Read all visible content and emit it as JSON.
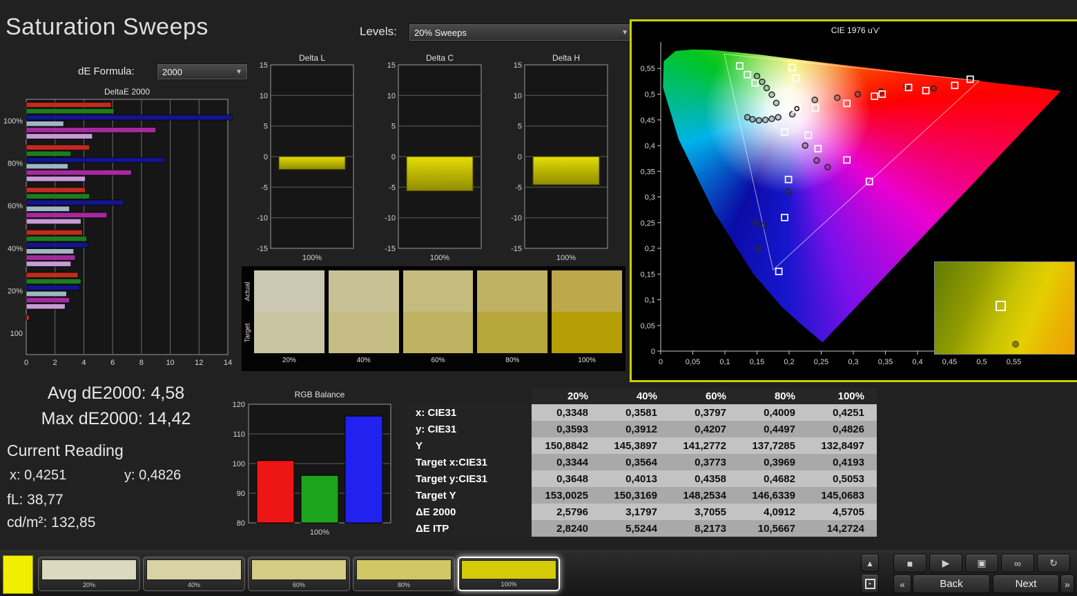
{
  "header": {
    "title": "Saturation Sweeps",
    "levels_label": "Levels:",
    "levels_value": "20% Sweeps"
  },
  "de_formula": {
    "label": "dE Formula:",
    "value": "2000"
  },
  "icons": {
    "dropdown_arrow": "▼",
    "stop": "■",
    "play": "▶",
    "capture": "▣",
    "continuous": "∞",
    "loop": "↻",
    "chevrons_left": "«",
    "chevrons_right": "»",
    "panel_up": "▴",
    "pattern_square": "▪"
  },
  "stats": {
    "avg": "Avg dE2000: 4,58",
    "max": "Max dE2000: 14,42",
    "current_reading_label": "Current Reading",
    "x": "x: 0,4251",
    "y": "y: 0,4826",
    "fl": "fL: 38,77",
    "cdm2": "cd/m²: 132,85"
  },
  "swatch_strip": {
    "row_labels": [
      "Actual",
      "Target"
    ],
    "columns": [
      {
        "label": "20%",
        "actual": "#cbc7b2",
        "target": "#c9c5a3"
      },
      {
        "label": "40%",
        "actual": "#c8c196",
        "target": "#c5bd83"
      },
      {
        "label": "60%",
        "actual": "#c4bb7c",
        "target": "#bfb260"
      },
      {
        "label": "80%",
        "actual": "#c0b263",
        "target": "#b7a63a"
      },
      {
        "label": "100%",
        "actual": "#bda84b",
        "target": "#b69e06"
      }
    ]
  },
  "table": {
    "headers": [
      "",
      "20%",
      "40%",
      "60%",
      "80%",
      "100%"
    ],
    "rows": [
      {
        "label": "x: CIE31",
        "values": [
          "0,3348",
          "0,3581",
          "0,3797",
          "0,4009",
          "0,4251"
        ]
      },
      {
        "label": "y: CIE31",
        "values": [
          "0,3593",
          "0,3912",
          "0,4207",
          "0,4497",
          "0,4826"
        ]
      },
      {
        "label": "Y",
        "values": [
          "150,8842",
          "145,3897",
          "141,2772",
          "137,7285",
          "132,8497"
        ]
      },
      {
        "label": "Target x:CIE31",
        "values": [
          "0,3344",
          "0,3564",
          "0,3773",
          "0,3969",
          "0,4193"
        ]
      },
      {
        "label": "Target y:CIE31",
        "values": [
          "0,3648",
          "0,4013",
          "0,4358",
          "0,4682",
          "0,5053"
        ]
      },
      {
        "label": "Target Y",
        "values": [
          "153,0025",
          "150,3169",
          "148,2534",
          "146,6339",
          "145,0683"
        ]
      },
      {
        "label": "ΔE 2000",
        "values": [
          "2,5796",
          "3,1797",
          "3,7055",
          "4,0912",
          "4,5705"
        ]
      },
      {
        "label": "ΔE ITP",
        "values": [
          "2,8240",
          "5,5244",
          "8,2173",
          "10,5667",
          "14,2724"
        ]
      }
    ]
  },
  "bottom_bar": {
    "current_patch_color": "#f2ee00",
    "swatches": [
      {
        "label": "20%",
        "color": "#dcd9c0",
        "selected": false
      },
      {
        "label": "40%",
        "color": "#d9d3a4",
        "selected": false
      },
      {
        "label": "60%",
        "color": "#d5cc84",
        "selected": false
      },
      {
        "label": "80%",
        "color": "#d1c765",
        "selected": false
      },
      {
        "label": "100%",
        "color": "#d5ca08",
        "selected": true
      }
    ],
    "back_label": "Back",
    "next_label": "Next"
  },
  "chart_data": [
    {
      "id": "deltae2000",
      "type": "bar",
      "orientation": "horizontal",
      "title": "DeltaE 2000",
      "groups": [
        "100%",
        "80%",
        "60%",
        "40%",
        "20%",
        "100"
      ],
      "series": [
        {
          "name": "red",
          "color": "#bf2b20",
          "values": [
            5.9,
            4.4,
            4.1,
            3.9,
            3.6,
            0.2
          ]
        },
        {
          "name": "green",
          "color": "#1e7c1e",
          "values": [
            6.1,
            3.1,
            4.4,
            4.2,
            3.8,
            null
          ]
        },
        {
          "name": "blue",
          "color": "#14148c",
          "values": [
            14.3,
            9.6,
            6.8,
            4.3,
            3.7,
            null
          ]
        },
        {
          "name": "cyan",
          "color": "#9fb6c6",
          "values": [
            2.6,
            2.9,
            3.0,
            3.3,
            2.8,
            null
          ]
        },
        {
          "name": "magenta",
          "color": "#a62a9e",
          "values": [
            9.0,
            7.3,
            5.6,
            3.4,
            3.0,
            null
          ]
        },
        {
          "name": "violet",
          "color": "#c79ad6",
          "values": [
            4.6,
            4.1,
            3.8,
            3.1,
            2.7,
            null
          ]
        }
      ],
      "xlim": [
        0,
        14
      ],
      "xticks": [
        0,
        2,
        4,
        6,
        8,
        10,
        12,
        14
      ]
    },
    {
      "id": "delta_l",
      "type": "bar",
      "title": "Delta L",
      "categories": [
        "100%"
      ],
      "values": [
        -2.1
      ],
      "ylim": [
        -15,
        15
      ],
      "yticks": [
        15,
        10,
        5,
        0,
        -5,
        -10,
        -15
      ]
    },
    {
      "id": "delta_c",
      "type": "bar",
      "title": "Delta C",
      "categories": [
        "100%"
      ],
      "values": [
        -5.6
      ],
      "ylim": [
        -15,
        15
      ],
      "yticks": [
        15,
        10,
        5,
        0,
        -5,
        -10,
        -15
      ]
    },
    {
      "id": "delta_h",
      "type": "bar",
      "title": "Delta H",
      "categories": [
        "100%"
      ],
      "values": [
        -4.6
      ],
      "ylim": [
        -15,
        15
      ],
      "yticks": [
        15,
        10,
        5,
        0,
        -5,
        -10,
        -15
      ]
    },
    {
      "id": "rgb_balance",
      "type": "bar",
      "title": "RGB Balance",
      "categories": [
        "Red",
        "Green",
        "Blue"
      ],
      "values": [
        101,
        96,
        116
      ],
      "colors": [
        "#ee1515",
        "#1ca51c",
        "#2222f0"
      ],
      "ylim": [
        80,
        120
      ],
      "yticks": [
        120,
        110,
        100,
        90,
        80
      ],
      "xlabel": "100%"
    },
    {
      "id": "cie",
      "type": "scatter",
      "title": "CIE 1976 u'v'",
      "axis_ticks": [
        "0",
        "0,05",
        "0,1",
        "0,15",
        "0,2",
        "0,25",
        "0,3",
        "0,35",
        "0,4",
        "0,45",
        "0,5",
        "0,55"
      ],
      "tick_step": 0.05,
      "white_point": [
        0.198,
        0.468
      ],
      "locus": [
        [
          0.252,
          0.017
        ],
        [
          0.235,
          0.035
        ],
        [
          0.216,
          0.055
        ],
        [
          0.188,
          0.087
        ],
        [
          0.144,
          0.151
        ],
        [
          0.083,
          0.271
        ],
        [
          0.028,
          0.412
        ],
        [
          0.0035,
          0.513
        ],
        [
          0.0046,
          0.564
        ],
        [
          0.0231,
          0.584
        ],
        [
          0.05,
          0.587
        ],
        [
          0.079,
          0.586
        ],
        [
          0.113,
          0.582
        ],
        [
          0.153,
          0.577
        ],
        [
          0.203,
          0.569
        ],
        [
          0.262,
          0.56
        ],
        [
          0.332,
          0.55
        ],
        [
          0.403,
          0.539
        ],
        [
          0.469,
          0.53
        ],
        [
          0.52,
          0.522
        ],
        [
          0.583,
          0.513
        ],
        [
          0.623,
          0.506
        ]
      ],
      "gamut_triangle": [
        [
          0.496,
          0.526
        ],
        [
          0.099,
          0.578
        ],
        [
          0.175,
          0.158
        ]
      ],
      "targets": [
        [
          0.123,
          0.555
        ],
        [
          0.135,
          0.538
        ],
        [
          0.147,
          0.522
        ],
        [
          0.205,
          0.552
        ],
        [
          0.211,
          0.531
        ],
        [
          0.482,
          0.529
        ],
        [
          0.458,
          0.517
        ],
        [
          0.413,
          0.507
        ],
        [
          0.386,
          0.513
        ],
        [
          0.345,
          0.5
        ],
        [
          0.333,
          0.496
        ],
        [
          0.29,
          0.482
        ],
        [
          0.241,
          0.473
        ],
        [
          0.193,
          0.426
        ],
        [
          0.23,
          0.42
        ],
        [
          0.245,
          0.394
        ],
        [
          0.29,
          0.372
        ],
        [
          0.325,
          0.33
        ],
        [
          0.199,
          0.334
        ],
        [
          0.193,
          0.26
        ],
        [
          0.184,
          0.155
        ]
      ],
      "measurements": [
        [
          0.15,
          0.535
        ],
        [
          0.158,
          0.524
        ],
        [
          0.165,
          0.512
        ],
        [
          0.173,
          0.499
        ],
        [
          0.18,
          0.483
        ],
        [
          0.135,
          0.455
        ],
        [
          0.143,
          0.451
        ],
        [
          0.153,
          0.449
        ],
        [
          0.163,
          0.45
        ],
        [
          0.173,
          0.452
        ],
        [
          0.183,
          0.455
        ],
        [
          0.205,
          0.461
        ],
        [
          0.24,
          0.489
        ],
        [
          0.275,
          0.493
        ],
        [
          0.307,
          0.5
        ],
        [
          0.343,
          0.505
        ],
        [
          0.383,
          0.515
        ],
        [
          0.425,
          0.511
        ],
        [
          0.225,
          0.4
        ],
        [
          0.243,
          0.371
        ],
        [
          0.26,
          0.358
        ],
        [
          0.199,
          0.31
        ],
        [
          0.16,
          0.244
        ],
        [
          0.152,
          0.2
        ],
        [
          0.148,
          0.25
        ]
      ],
      "current": [
        0.212,
        0.472
      ]
    }
  ]
}
